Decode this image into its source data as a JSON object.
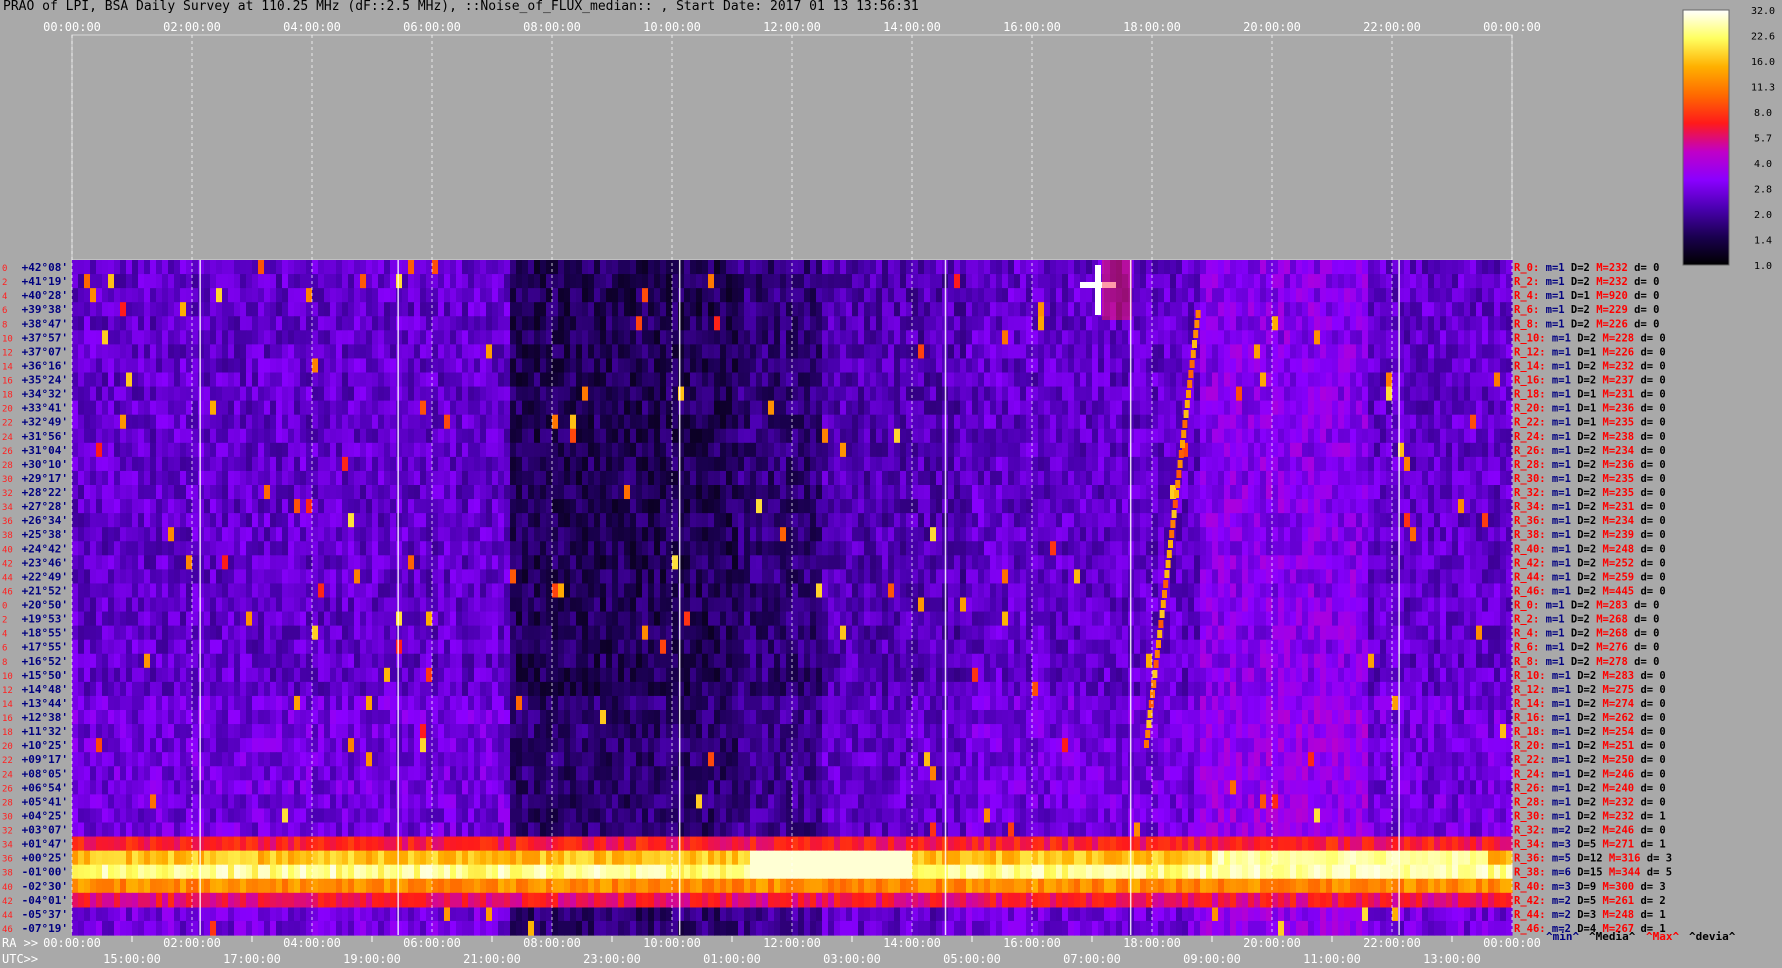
{
  "header": {
    "title": "PRAO of LPI, BSA Daily Survey at 110.25 MHz (dF::2.5 MHz), ::Noise_of_FLUX_median:: , Start Date: 2017 01 13 13:56:31"
  },
  "colorbar": {
    "ticks": [
      "32.0",
      "22.6",
      "16.0",
      "11.3",
      "8.0",
      "5.7",
      "4.0",
      "2.8",
      "2.0",
      "1.4",
      "1.0"
    ],
    "stops": [
      "#000000",
      "#1a0050",
      "#4a00b0",
      "#8a00ff",
      "#c000c8",
      "#ff1a1a",
      "#ff6a00",
      "#ffb000",
      "#ffff60",
      "#ffffff"
    ]
  },
  "axes": {
    "top_ticks": [
      "00:00:00",
      "02:00:00",
      "04:00:00",
      "06:00:00",
      "08:00:00",
      "10:00:00",
      "12:00:00",
      "14:00:00",
      "16:00:00",
      "18:00:00",
      "20:00:00",
      "22:00:00",
      "00:00:00"
    ],
    "bottom_ra_label": "RA >>",
    "bottom_ra_ticks": [
      "00:00:00",
      "02:00:00",
      "04:00:00",
      "06:00:00",
      "08:00:00",
      "10:00:00",
      "12:00:00",
      "14:00:00",
      "16:00:00",
      "18:00:00",
      "20:00:00",
      "22:00:00",
      "00:00:00"
    ],
    "bottom_utc_label": "UTC>>",
    "bottom_utc_ticks": [
      "15:00:00",
      "17:00:00",
      "19:00:00",
      "21:00:00",
      "23:00:00",
      "01:00:00",
      "03:00:00",
      "05:00:00",
      "07:00:00",
      "09:00:00",
      "11:00:00",
      "13:00:00"
    ]
  },
  "footer": {
    "legend": [
      {
        "text": "^min^",
        "color": "#000080"
      },
      {
        "text": "^Media^",
        "color": "#000000"
      },
      {
        "text": "^Max^",
        "color": "#ff0000"
      },
      {
        "text": "^devia^",
        "color": "#000000"
      }
    ]
  },
  "chart_data": {
    "type": "heatmap",
    "title": "PRAO of LPI, BSA Daily Survey at 110.25 MHz (dF::2.5 MHz), ::Noise_of_FLUX_median:: , Start Date: 2017 01 13 13:56:31",
    "x_ticks_ra": [
      "00:00:00",
      "02:00:00",
      "04:00:00",
      "06:00:00",
      "08:00:00",
      "10:00:00",
      "12:00:00",
      "14:00:00",
      "16:00:00",
      "18:00:00",
      "20:00:00",
      "22:00:00",
      "00:00:00"
    ],
    "color_scale_ticks": [
      32.0,
      22.6,
      16.0,
      11.3,
      8.0,
      5.7,
      4.0,
      2.8,
      2.0,
      1.4,
      1.0
    ],
    "row_index_labels": [
      "0",
      "2",
      "4",
      "6",
      "8",
      "10",
      "12",
      "14",
      "16",
      "18",
      "20",
      "22",
      "24",
      "26",
      "28",
      "30",
      "32",
      "34",
      "36",
      "38",
      "40",
      "42",
      "44",
      "46",
      "0",
      "2",
      "4",
      "6",
      "8",
      "10",
      "12",
      "14",
      "16",
      "18",
      "20",
      "22",
      "24",
      "26",
      "28",
      "30",
      "32",
      "34",
      "36",
      "38",
      "40",
      "42",
      "44",
      "46"
    ],
    "declinations": [
      "+42°08'",
      "+41°19'",
      "+40°28'",
      "+39°38'",
      "+38°47'",
      "+37°57'",
      "+37°07'",
      "+36°16'",
      "+35°24'",
      "+34°32'",
      "+33°41'",
      "+32°49'",
      "+31°56'",
      "+31°04'",
      "+30°10'",
      "+29°17'",
      "+28°22'",
      "+27°28'",
      "+26°34'",
      "+25°38'",
      "+24°42'",
      "+23°46'",
      "+22°49'",
      "+21°52'",
      "+20°50'",
      "+19°53'",
      "+18°55'",
      "+17°55'",
      "+16°52'",
      "+15°50'",
      "+14°48'",
      "+13°44'",
      "+12°38'",
      "+11°32'",
      "+10°25'",
      "+09°17'",
      "+08°05'",
      "+06°54'",
      "+05°41'",
      "+04°25'",
      "+03°07'",
      "+01°47'",
      "+00°25'",
      "-01°00'",
      "-02°30'",
      "-04°01'",
      "-05°37'",
      "-07°19'"
    ],
    "row_stats": [
      {
        "r": "R_0:",
        "m": "m=1",
        "d": "D=2",
        "max": "M=232",
        "dev": "d= 0"
      },
      {
        "r": "R_2:",
        "m": "m=1",
        "d": "D=2",
        "max": "M=232",
        "dev": "d= 0"
      },
      {
        "r": "R_4:",
        "m": "m=1",
        "d": "D=1",
        "max": "M=920",
        "dev": "d= 0"
      },
      {
        "r": "R_6:",
        "m": "m=1",
        "d": "D=2",
        "max": "M=229",
        "dev": "d= 0"
      },
      {
        "r": "R_8:",
        "m": "m=1",
        "d": "D=2",
        "max": "M=226",
        "dev": "d= 0"
      },
      {
        "r": "R_10:",
        "m": "m=1",
        "d": "D=2",
        "max": "M=228",
        "dev": "d= 0"
      },
      {
        "r": "R_12:",
        "m": "m=1",
        "d": "D=1",
        "max": "M=226",
        "dev": "d= 0"
      },
      {
        "r": "R_14:",
        "m": "m=1",
        "d": "D=2",
        "max": "M=232",
        "dev": "d= 0"
      },
      {
        "r": "R_16:",
        "m": "m=1",
        "d": "D=2",
        "max": "M=237",
        "dev": "d= 0"
      },
      {
        "r": "R_18:",
        "m": "m=1",
        "d": "D=1",
        "max": "M=231",
        "dev": "d= 0"
      },
      {
        "r": "R_20:",
        "m": "m=1",
        "d": "D=1",
        "max": "M=236",
        "dev": "d= 0"
      },
      {
        "r": "R_22:",
        "m": "m=1",
        "d": "D=1",
        "max": "M=235",
        "dev": "d= 0"
      },
      {
        "r": "R_24:",
        "m": "m=1",
        "d": "D=2",
        "max": "M=238",
        "dev": "d= 0"
      },
      {
        "r": "R_26:",
        "m": "m=1",
        "d": "D=2",
        "max": "M=234",
        "dev": "d= 0"
      },
      {
        "r": "R_28:",
        "m": "m=1",
        "d": "D=2",
        "max": "M=236",
        "dev": "d= 0"
      },
      {
        "r": "R_30:",
        "m": "m=1",
        "d": "D=2",
        "max": "M=235",
        "dev": "d= 0"
      },
      {
        "r": "R_32:",
        "m": "m=1",
        "d": "D=2",
        "max": "M=235",
        "dev": "d= 0"
      },
      {
        "r": "R_34:",
        "m": "m=1",
        "d": "D=2",
        "max": "M=231",
        "dev": "d= 0"
      },
      {
        "r": "R_36:",
        "m": "m=1",
        "d": "D=2",
        "max": "M=234",
        "dev": "d= 0"
      },
      {
        "r": "R_38:",
        "m": "m=1",
        "d": "D=2",
        "max": "M=239",
        "dev": "d= 0"
      },
      {
        "r": "R_40:",
        "m": "m=1",
        "d": "D=2",
        "max": "M=248",
        "dev": "d= 0"
      },
      {
        "r": "R_42:",
        "m": "m=1",
        "d": "D=2",
        "max": "M=252",
        "dev": "d= 0"
      },
      {
        "r": "R_44:",
        "m": "m=1",
        "d": "D=2",
        "max": "M=259",
        "dev": "d= 0"
      },
      {
        "r": "R_46:",
        "m": "m=1",
        "d": "D=2",
        "max": "M=445",
        "dev": "d= 0"
      },
      {
        "r": "R_0:",
        "m": "m=1",
        "d": "D=2",
        "max": "M=283",
        "dev": "d= 0"
      },
      {
        "r": "R_2:",
        "m": "m=1",
        "d": "D=2",
        "max": "M=268",
        "dev": "d= 0"
      },
      {
        "r": "R_4:",
        "m": "m=1",
        "d": "D=2",
        "max": "M=268",
        "dev": "d= 0"
      },
      {
        "r": "R_6:",
        "m": "m=1",
        "d": "D=2",
        "max": "M=276",
        "dev": "d= 0"
      },
      {
        "r": "R_8:",
        "m": "m=1",
        "d": "D=2",
        "max": "M=278",
        "dev": "d= 0"
      },
      {
        "r": "R_10:",
        "m": "m=1",
        "d": "D=2",
        "max": "M=283",
        "dev": "d= 0"
      },
      {
        "r": "R_12:",
        "m": "m=1",
        "d": "D=2",
        "max": "M=275",
        "dev": "d= 0"
      },
      {
        "r": "R_14:",
        "m": "m=1",
        "d": "D=2",
        "max": "M=274",
        "dev": "d= 0"
      },
      {
        "r": "R_16:",
        "m": "m=1",
        "d": "D=2",
        "max": "M=262",
        "dev": "d= 0"
      },
      {
        "r": "R_18:",
        "m": "m=1",
        "d": "D=2",
        "max": "M=254",
        "dev": "d= 0"
      },
      {
        "r": "R_20:",
        "m": "m=1",
        "d": "D=2",
        "max": "M=251",
        "dev": "d= 0"
      },
      {
        "r": "R_22:",
        "m": "m=1",
        "d": "D=2",
        "max": "M=250",
        "dev": "d= 0"
      },
      {
        "r": "R_24:",
        "m": "m=1",
        "d": "D=2",
        "max": "M=246",
        "dev": "d= 0"
      },
      {
        "r": "R_26:",
        "m": "m=1",
        "d": "D=2",
        "max": "M=240",
        "dev": "d= 0"
      },
      {
        "r": "R_28:",
        "m": "m=1",
        "d": "D=2",
        "max": "M=232",
        "dev": "d= 0"
      },
      {
        "r": "R_30:",
        "m": "m=1",
        "d": "D=2",
        "max": "M=232",
        "dev": "d= 1"
      },
      {
        "r": "R_32:",
        "m": "m=2",
        "d": "D=2",
        "max": "M=246",
        "dev": "d= 0"
      },
      {
        "r": "R_34:",
        "m": "m=3",
        "d": "D=5",
        "max": "M=271",
        "dev": "d= 1"
      },
      {
        "r": "R_36:",
        "m": "m=5",
        "d": "D=12",
        "max": "M=316",
        "dev": "d= 3"
      },
      {
        "r": "R_38:",
        "m": "m=6",
        "d": "D=15",
        "max": "M=344",
        "dev": "d= 5"
      },
      {
        "r": "R_40:",
        "m": "m=3",
        "d": "D=9",
        "max": "M=300",
        "dev": "d= 3"
      },
      {
        "r": "R_42:",
        "m": "m=2",
        "d": "D=5",
        "max": "M=261",
        "dev": "d= 2"
      },
      {
        "r": "R_44:",
        "m": "m=2",
        "d": "D=3",
        "max": "M=248",
        "dev": "d= 1"
      },
      {
        "r": "R_46:",
        "m": "m=2",
        "d": "D=4",
        "max": "M=267",
        "dev": "d= 1"
      }
    ]
  }
}
